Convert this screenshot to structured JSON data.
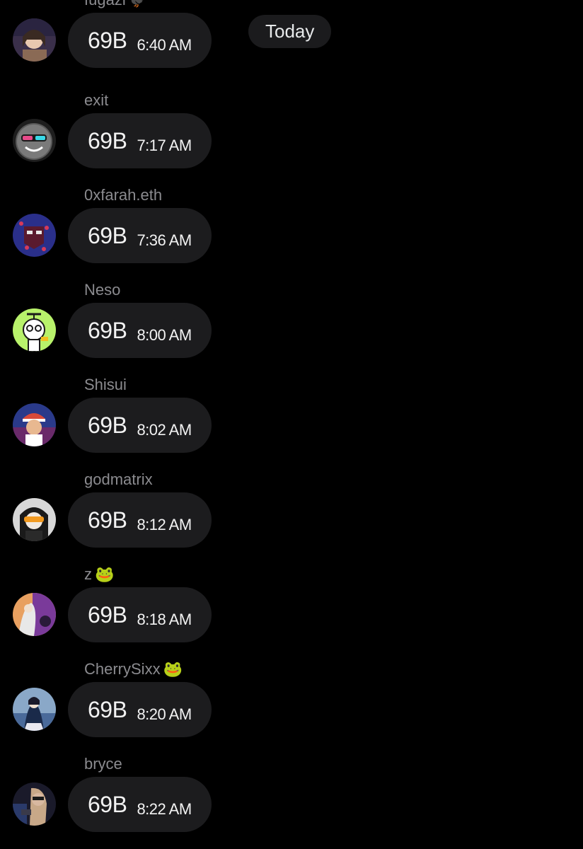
{
  "date_separator": "Today",
  "messages": [
    {
      "sender": "fugazi",
      "sender_emoji": "🐦‍⬛",
      "text": "69B",
      "time": "6:40 AM",
      "avatar_colors": [
        "#3a2f4a",
        "#8a6a55"
      ]
    },
    {
      "sender": "exit",
      "sender_emoji": "",
      "text": "69B",
      "time": "7:17 AM",
      "avatar_colors": [
        "#2b2b2b",
        "#7a7a7a"
      ]
    },
    {
      "sender": "0xfarah.eth",
      "sender_emoji": "",
      "text": "69B",
      "time": "7:36 AM",
      "avatar_colors": [
        "#5a1a2e",
        "#2a2f8a"
      ]
    },
    {
      "sender": "Neso",
      "sender_emoji": "",
      "text": "69B",
      "time": "8:00 AM",
      "avatar_colors": [
        "#b8f26b",
        "#ffffff"
      ]
    },
    {
      "sender": "Shisui",
      "sender_emoji": "",
      "text": "69B",
      "time": "8:02 AM",
      "avatar_colors": [
        "#2a3a8a",
        "#d84a3a"
      ]
    },
    {
      "sender": "godmatrix",
      "sender_emoji": "",
      "text": "69B",
      "time": "8:12 AM",
      "avatar_colors": [
        "#1a1a1a",
        "#f29a20"
      ]
    },
    {
      "sender": "z",
      "sender_emoji": "🐸",
      "text": "69B",
      "time": "8:18 AM",
      "avatar_colors": [
        "#7a3a9a",
        "#e8e8e8"
      ]
    },
    {
      "sender": "CherrySixx",
      "sender_emoji": "🐸",
      "text": "69B",
      "time": "8:20 AM",
      "avatar_colors": [
        "#4a6a9a",
        "#1a2a4a"
      ]
    },
    {
      "sender": "bryce",
      "sender_emoji": "",
      "text": "69B",
      "time": "8:22 AM",
      "avatar_colors": [
        "#1a1a2a",
        "#d8b8a0"
      ]
    }
  ]
}
